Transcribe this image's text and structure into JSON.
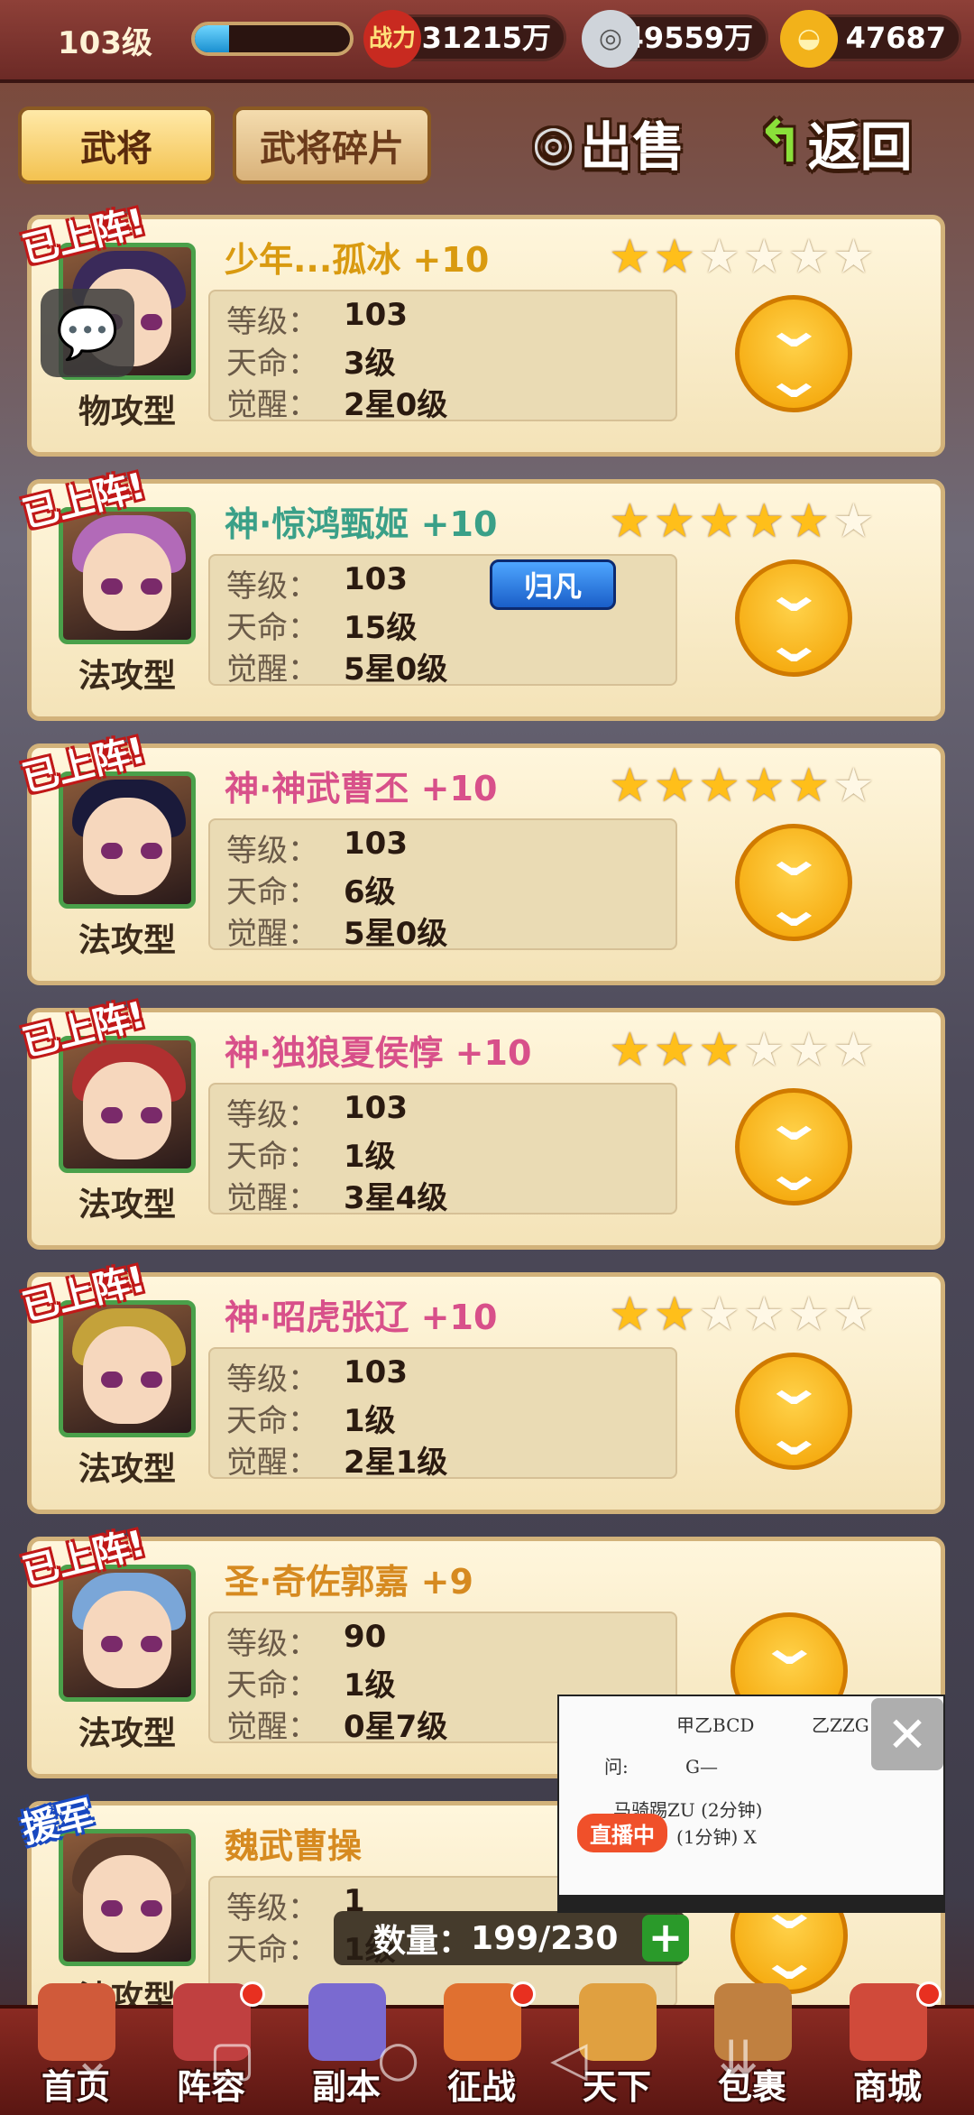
{
  "topbar": {
    "level": "103级",
    "exp_progress": 0.22,
    "power_label": "战力",
    "power_value": "231215万",
    "coins_value": "49559万",
    "ingot_value": "47687"
  },
  "tabs": [
    {
      "label": "武将",
      "active": true
    },
    {
      "label": "武将碎片",
      "active": false
    }
  ],
  "actions": {
    "sell_label": "出售",
    "back_label": "返回"
  },
  "stat_labels": {
    "level": "等级：",
    "destiny": "天命：",
    "awaken": "觉醒："
  },
  "heroes": [
    {
      "badge": "已上阵!",
      "name": "少年...孤冰 +10",
      "name_color": "#d99a10",
      "type": "物攻型",
      "stars": 2,
      "level": "103",
      "destiny": "3级",
      "awaken": "2星0级",
      "tag": "",
      "hair": "#3a2a5a"
    },
    {
      "badge": "已上阵!",
      "name": "神·惊鸿甄姬 +10",
      "name_color": "#3aa088",
      "type": "法攻型",
      "stars": 5,
      "level": "103",
      "destiny": "15级",
      "awaken": "5星0级",
      "tag": "归凡",
      "hair": "#b26ab8"
    },
    {
      "badge": "已上阵!",
      "name": "神·神武曹丕 +10",
      "name_color": "#d8508a",
      "type": "法攻型",
      "stars": 5,
      "level": "103",
      "destiny": "6级",
      "awaken": "5星0级",
      "tag": "",
      "hair": "#1a1a3a"
    },
    {
      "badge": "已上阵!",
      "name": "神·独狼夏侯惇 +10",
      "name_color": "#d8508a",
      "type": "法攻型",
      "stars": 3,
      "level": "103",
      "destiny": "1级",
      "awaken": "3星4级",
      "tag": "",
      "hair": "#b03030"
    },
    {
      "badge": "已上阵!",
      "name": "神·昭虎张辽 +10",
      "name_color": "#d8508a",
      "type": "法攻型",
      "stars": 2,
      "level": "103",
      "destiny": "1级",
      "awaken": "2星1级",
      "tag": "",
      "hair": "#c4a23a"
    },
    {
      "badge": "已上阵!",
      "name": "圣·奇佐郭嘉 +9",
      "name_color": "#d68a20",
      "type": "法攻型",
      "stars": 0,
      "level": "90",
      "destiny": "1级",
      "awaken": "0星7级",
      "tag": "",
      "hair": "#7aa6d8"
    },
    {
      "badge": "援军",
      "name": "魏武曹操",
      "name_color": "#d68a20",
      "type": "法攻型",
      "stars": 0,
      "level": "1",
      "destiny": "1级",
      "awaken": "",
      "tag": "",
      "hair": "#5a3a2a"
    }
  ],
  "quantity": {
    "label": "数量：",
    "value": "199/230"
  },
  "overlay": {
    "live_label": "直播中",
    "note_1": "甲乙BCD",
    "note_2": "乙ZZG",
    "note_3": "问:",
    "note_4": "G—",
    "note_5": "马骑踢ZU (2分钟)",
    "note_6": "(1分钟) X"
  },
  "nav": [
    {
      "label": "首页",
      "color": "#d05a3a",
      "dot": false
    },
    {
      "label": "阵容",
      "color": "#c04040",
      "dot": true
    },
    {
      "label": "副本",
      "color": "#7a6ad0",
      "dot": false
    },
    {
      "label": "征战",
      "color": "#e07030",
      "dot": true
    },
    {
      "label": "天下",
      "color": "#e0a040",
      "dot": false
    },
    {
      "label": "包裹",
      "color": "#c08040",
      "dot": false
    },
    {
      "label": "商城",
      "color": "#d04a3a",
      "dot": true
    }
  ]
}
